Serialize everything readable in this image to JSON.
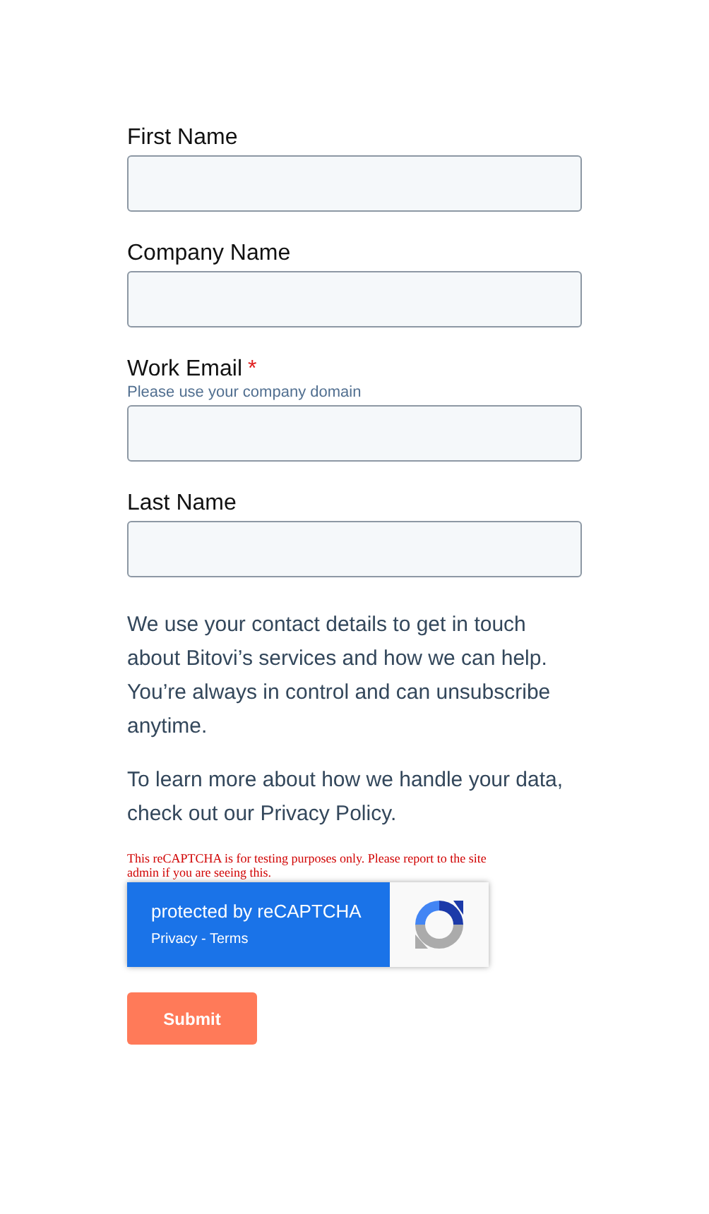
{
  "fields": [
    {
      "label": "First Name"
    },
    {
      "label": "Company Name"
    },
    {
      "label": "Work Email",
      "required_mark": "*",
      "hint": "Please use your company domain"
    },
    {
      "label": "Last Name"
    }
  ],
  "paragraphs": [
    "We use your contact details to get in touch about Bitovi’s services and how we can help. You’re always in control and can unsubscribe anytime.",
    "To learn more about how we handle your data, check out our Privacy Policy."
  ],
  "recaptcha": {
    "warning": "This reCAPTCHA is for testing purposes only. Please report to the site admin if you are seeing this.",
    "title": "protected by reCAPTCHA",
    "links": "Privacy - Terms"
  },
  "submit": "Submit"
}
